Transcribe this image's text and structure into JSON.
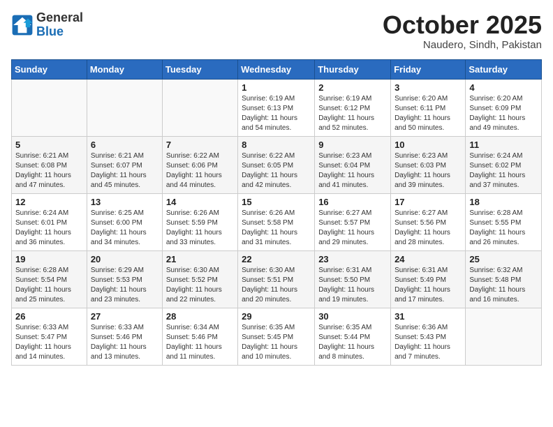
{
  "header": {
    "logo_line1": "General",
    "logo_line2": "Blue",
    "month_title": "October 2025",
    "location": "Naudero, Sindh, Pakistan"
  },
  "weekdays": [
    "Sunday",
    "Monday",
    "Tuesday",
    "Wednesday",
    "Thursday",
    "Friday",
    "Saturday"
  ],
  "weeks": [
    [
      {
        "day": "",
        "info": ""
      },
      {
        "day": "",
        "info": ""
      },
      {
        "day": "",
        "info": ""
      },
      {
        "day": "1",
        "info": "Sunrise: 6:19 AM\nSunset: 6:13 PM\nDaylight: 11 hours\nand 54 minutes."
      },
      {
        "day": "2",
        "info": "Sunrise: 6:19 AM\nSunset: 6:12 PM\nDaylight: 11 hours\nand 52 minutes."
      },
      {
        "day": "3",
        "info": "Sunrise: 6:20 AM\nSunset: 6:11 PM\nDaylight: 11 hours\nand 50 minutes."
      },
      {
        "day": "4",
        "info": "Sunrise: 6:20 AM\nSunset: 6:09 PM\nDaylight: 11 hours\nand 49 minutes."
      }
    ],
    [
      {
        "day": "5",
        "info": "Sunrise: 6:21 AM\nSunset: 6:08 PM\nDaylight: 11 hours\nand 47 minutes."
      },
      {
        "day": "6",
        "info": "Sunrise: 6:21 AM\nSunset: 6:07 PM\nDaylight: 11 hours\nand 45 minutes."
      },
      {
        "day": "7",
        "info": "Sunrise: 6:22 AM\nSunset: 6:06 PM\nDaylight: 11 hours\nand 44 minutes."
      },
      {
        "day": "8",
        "info": "Sunrise: 6:22 AM\nSunset: 6:05 PM\nDaylight: 11 hours\nand 42 minutes."
      },
      {
        "day": "9",
        "info": "Sunrise: 6:23 AM\nSunset: 6:04 PM\nDaylight: 11 hours\nand 41 minutes."
      },
      {
        "day": "10",
        "info": "Sunrise: 6:23 AM\nSunset: 6:03 PM\nDaylight: 11 hours\nand 39 minutes."
      },
      {
        "day": "11",
        "info": "Sunrise: 6:24 AM\nSunset: 6:02 PM\nDaylight: 11 hours\nand 37 minutes."
      }
    ],
    [
      {
        "day": "12",
        "info": "Sunrise: 6:24 AM\nSunset: 6:01 PM\nDaylight: 11 hours\nand 36 minutes."
      },
      {
        "day": "13",
        "info": "Sunrise: 6:25 AM\nSunset: 6:00 PM\nDaylight: 11 hours\nand 34 minutes."
      },
      {
        "day": "14",
        "info": "Sunrise: 6:26 AM\nSunset: 5:59 PM\nDaylight: 11 hours\nand 33 minutes."
      },
      {
        "day": "15",
        "info": "Sunrise: 6:26 AM\nSunset: 5:58 PM\nDaylight: 11 hours\nand 31 minutes."
      },
      {
        "day": "16",
        "info": "Sunrise: 6:27 AM\nSunset: 5:57 PM\nDaylight: 11 hours\nand 29 minutes."
      },
      {
        "day": "17",
        "info": "Sunrise: 6:27 AM\nSunset: 5:56 PM\nDaylight: 11 hours\nand 28 minutes."
      },
      {
        "day": "18",
        "info": "Sunrise: 6:28 AM\nSunset: 5:55 PM\nDaylight: 11 hours\nand 26 minutes."
      }
    ],
    [
      {
        "day": "19",
        "info": "Sunrise: 6:28 AM\nSunset: 5:54 PM\nDaylight: 11 hours\nand 25 minutes."
      },
      {
        "day": "20",
        "info": "Sunrise: 6:29 AM\nSunset: 5:53 PM\nDaylight: 11 hours\nand 23 minutes."
      },
      {
        "day": "21",
        "info": "Sunrise: 6:30 AM\nSunset: 5:52 PM\nDaylight: 11 hours\nand 22 minutes."
      },
      {
        "day": "22",
        "info": "Sunrise: 6:30 AM\nSunset: 5:51 PM\nDaylight: 11 hours\nand 20 minutes."
      },
      {
        "day": "23",
        "info": "Sunrise: 6:31 AM\nSunset: 5:50 PM\nDaylight: 11 hours\nand 19 minutes."
      },
      {
        "day": "24",
        "info": "Sunrise: 6:31 AM\nSunset: 5:49 PM\nDaylight: 11 hours\nand 17 minutes."
      },
      {
        "day": "25",
        "info": "Sunrise: 6:32 AM\nSunset: 5:48 PM\nDaylight: 11 hours\nand 16 minutes."
      }
    ],
    [
      {
        "day": "26",
        "info": "Sunrise: 6:33 AM\nSunset: 5:47 PM\nDaylight: 11 hours\nand 14 minutes."
      },
      {
        "day": "27",
        "info": "Sunrise: 6:33 AM\nSunset: 5:46 PM\nDaylight: 11 hours\nand 13 minutes."
      },
      {
        "day": "28",
        "info": "Sunrise: 6:34 AM\nSunset: 5:46 PM\nDaylight: 11 hours\nand 11 minutes."
      },
      {
        "day": "29",
        "info": "Sunrise: 6:35 AM\nSunset: 5:45 PM\nDaylight: 11 hours\nand 10 minutes."
      },
      {
        "day": "30",
        "info": "Sunrise: 6:35 AM\nSunset: 5:44 PM\nDaylight: 11 hours\nand 8 minutes."
      },
      {
        "day": "31",
        "info": "Sunrise: 6:36 AM\nSunset: 5:43 PM\nDaylight: 11 hours\nand 7 minutes."
      },
      {
        "day": "",
        "info": ""
      }
    ]
  ]
}
